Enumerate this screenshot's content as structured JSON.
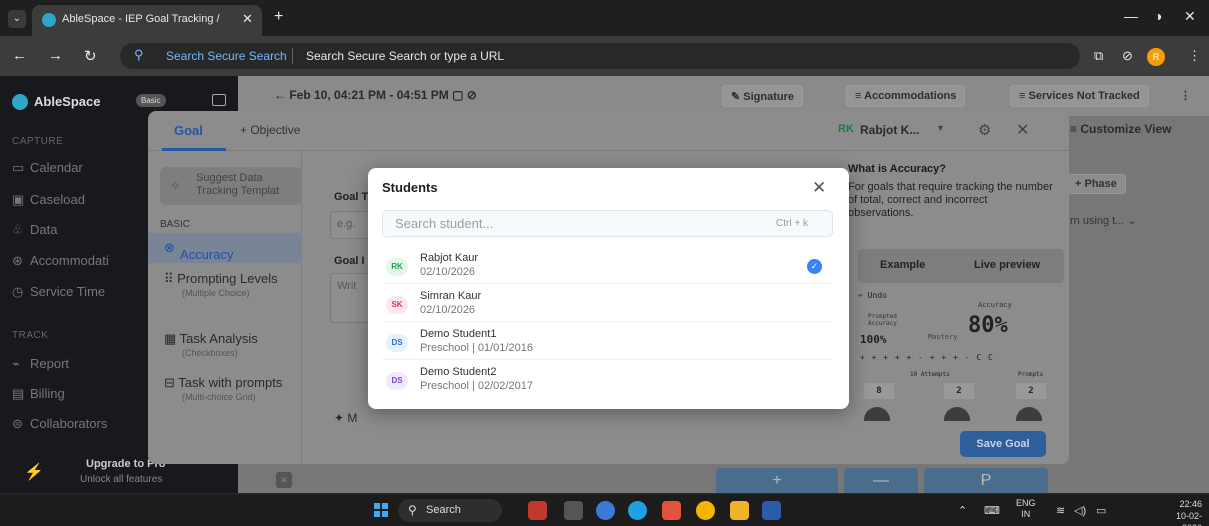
{
  "browser": {
    "tab_title": "AbleSpace - IEP Goal Tracking / ",
    "omnibox_engine": "Search Secure Search",
    "omnibox_placeholder": "Search Secure Search or type a URL",
    "profile_initial": "R"
  },
  "app": {
    "brand": "AbleSpace",
    "plan_badge": "Basic",
    "sidebar": {
      "capture_label": "CAPTURE",
      "capture_items": [
        {
          "label": "Calendar",
          "icon": "calendar-icon"
        },
        {
          "label": "Caseload",
          "icon": "caseload-icon"
        },
        {
          "label": "Data",
          "icon": "data-icon"
        },
        {
          "label": "Accommodati",
          "icon": "accommodations-icon"
        },
        {
          "label": "Service Time",
          "icon": "clock-icon"
        }
      ],
      "track_label": "TRACK",
      "track_items": [
        {
          "label": "Report",
          "icon": "chart-icon"
        },
        {
          "label": "Billing",
          "icon": "billing-icon"
        },
        {
          "label": "Collaborators",
          "icon": "collaborators-icon"
        }
      ],
      "upgrade_title": "Upgrade to Pro",
      "upgrade_sub": "Unlock all features"
    },
    "header": {
      "session_time": "Feb 10, 04:21 PM - 04:51 PM",
      "signature": "Signature",
      "accommodations": "Accommodations",
      "services_not_tracked": "Services Not Tracked"
    },
    "background": {
      "customize_view": "Customize View",
      "phase": "+ Phase",
      "pattern": "rn using t...",
      "keypad": [
        "+",
        "—",
        "P"
      ]
    }
  },
  "goal_modal": {
    "tab_goal": "Goal",
    "tab_objective": "+ Objective",
    "user_initials": "RK",
    "user_name": "Rabjot K...",
    "suggest_line1": "Suggest Data",
    "suggest_line2": "Tracking Templat",
    "basic_label": "BASIC",
    "options": [
      {
        "label": "Accuracy",
        "sub": ""
      },
      {
        "label": "Prompting Levels",
        "sub": "(Multiple Choice)"
      },
      {
        "label": "Task Analysis",
        "sub": "(Checkboxes)"
      },
      {
        "label": "Task with prompts",
        "sub": "(Multi-choice Grid)"
      }
    ],
    "goal_title_label": "Goal T",
    "goal_title_placeholder": "e.g.",
    "goal_desc_label": "Goal I",
    "goal_desc_placeholder": "Writ",
    "more_label": "M",
    "info_title": "What is Accuracy?",
    "info_desc": "For goals that require tracking the number of total, correct and incorrect observations.",
    "example_tab": "Example",
    "live_preview_tab": "Live preview",
    "preview": {
      "undo": "Undo",
      "prompted": "Prompted Accuracy",
      "accuracy": "Accuracy",
      "mastery": "Mastery",
      "big_pct": "80%",
      "small_pct": "100%",
      "marks": "+ + + + + - + + + - C C",
      "attempts": "10 Attempts",
      "prompts": "Prompts",
      "counts": [
        "8",
        "2",
        "2"
      ]
    },
    "save_goal": "Save Goal"
  },
  "students_dialog": {
    "title": "Students",
    "search_placeholder": "Search student...",
    "shortcut": "Ctrl + k",
    "students": [
      {
        "initials": "RK",
        "name": "Rabjot Kaur",
        "sub": "02/10/2026",
        "selected": true,
        "bg": "#e6f6ea",
        "fg": "#1f9d4d"
      },
      {
        "initials": "SK",
        "name": "Simran Kaur",
        "sub": "02/10/2026",
        "selected": false,
        "bg": "#fde7ec",
        "fg": "#d8345f"
      },
      {
        "initials": "DS",
        "name": "Demo Student1",
        "sub": "Preschool | 01/01/2016",
        "selected": false,
        "bg": "#e6f0fc",
        "fg": "#2f6fd0"
      },
      {
        "initials": "DS",
        "name": "Demo Student2",
        "sub": "Preschool | 02/02/2017",
        "selected": false,
        "bg": "#f1e9fb",
        "fg": "#7b45c9"
      }
    ]
  },
  "taskbar": {
    "search": "Search",
    "lang_line1": "ENG",
    "lang_line2": "IN",
    "time": "22:46",
    "date": "10-02-2026"
  }
}
